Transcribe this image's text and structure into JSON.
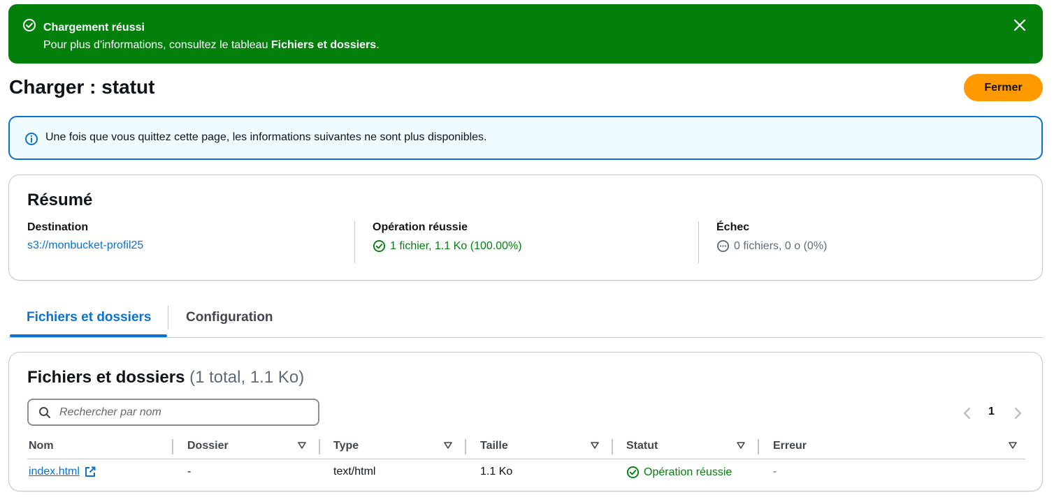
{
  "flash": {
    "title": "Chargement réussi",
    "message_prefix": "Pour plus d'informations, consultez le tableau ",
    "message_bold": "Fichiers et dossiers",
    "message_suffix": "."
  },
  "header": {
    "title": "Charger : statut",
    "close_label": "Fermer"
  },
  "info_alert": {
    "text": "Une fois que vous quittez cette page, les informations suivantes ne sont plus disponibles."
  },
  "summary": {
    "title": "Résumé",
    "destination": {
      "label": "Destination",
      "value": "s3://monbucket-profil25"
    },
    "succeeded": {
      "label": "Opération réussie",
      "value": "1 fichier, 1.1 Ko (100.00%)"
    },
    "failed": {
      "label": "Échec",
      "value": "0 fichiers, 0 o (0%)"
    }
  },
  "tabs": [
    {
      "label": "Fichiers et dossiers",
      "active": true
    },
    {
      "label": "Configuration",
      "active": false
    }
  ],
  "files": {
    "title": "Fichiers et dossiers",
    "count": "(1 total, 1.1 Ko)",
    "search_placeholder": "Rechercher par nom",
    "pagination": {
      "prev": "‹",
      "page": "1",
      "next": "›"
    },
    "columns": [
      "Nom",
      "Dossier",
      "Type",
      "Taille",
      "Statut",
      "Erreur"
    ],
    "rows": [
      {
        "name": "index.html",
        "folder": "-",
        "type": "text/html",
        "size": "1.1 Ko",
        "status": "Opération réussie",
        "error": "-"
      }
    ]
  },
  "colors": {
    "success": "#037f0c",
    "accent": "#0972d3",
    "primary_button": "#ff9900"
  }
}
